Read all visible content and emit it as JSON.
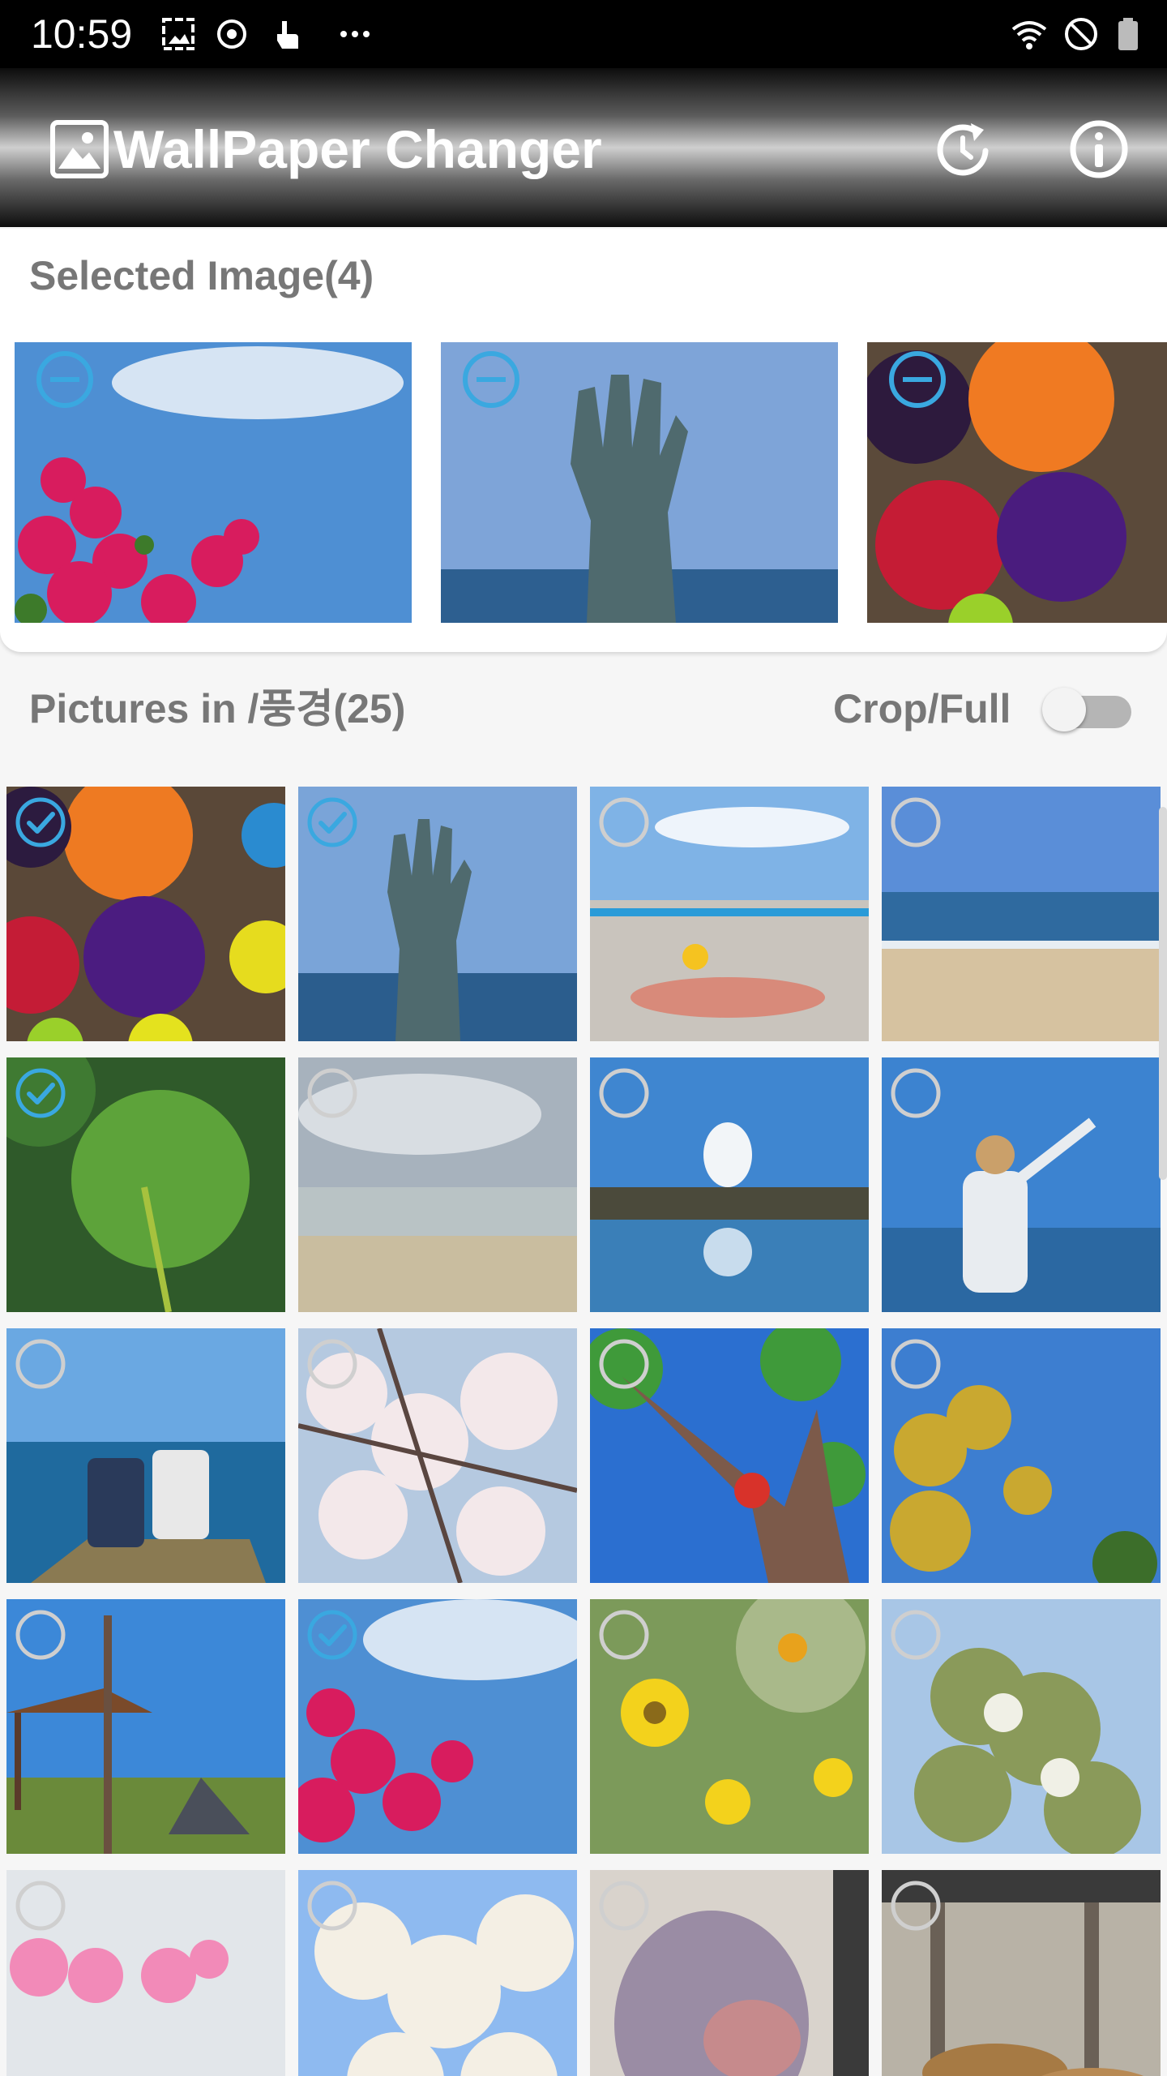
{
  "status_bar": {
    "time": "10:59",
    "left_icons": [
      "gallery-icon",
      "sync-icon",
      "touch-icon",
      "more-dots-icon"
    ],
    "right_icons": [
      "wifi-icon",
      "do-not-disturb-icon",
      "battery-icon"
    ]
  },
  "app_bar": {
    "title": "WallPaper Changer",
    "logo_icon": "picture-frame-icon",
    "actions": [
      "refresh-timer-icon",
      "info-icon"
    ]
  },
  "selected": {
    "title": "Selected Image(4)",
    "items": [
      {
        "scene": "red flowers against blue sky",
        "action_icon": "minus-circle-icon"
      },
      {
        "scene": "hand sculpture in the sea",
        "action_icon": "minus-circle-icon"
      },
      {
        "scene": "colorful umbrellas on a wall",
        "action_icon": "minus-circle-icon"
      }
    ]
  },
  "folder": {
    "title": "Pictures in /풍경(25)",
    "crop_label": "Crop/Full",
    "crop_toggle_on": false
  },
  "grid": [
    {
      "scene": "colorful umbrellas",
      "checked": true
    },
    {
      "scene": "hand sculpture in sea",
      "checked": true
    },
    {
      "scene": "pier with octopus painting",
      "checked": false
    },
    {
      "scene": "sandy beach and sea",
      "checked": false
    },
    {
      "scene": "lotus leaf with dragonfly",
      "checked": true
    },
    {
      "scene": "people wading on shore",
      "checked": false
    },
    {
      "scene": "calm water reflecting sky",
      "checked": false
    },
    {
      "scene": "person pointing at the sea",
      "checked": false
    },
    {
      "scene": "two kids sitting on a pier",
      "checked": false
    },
    {
      "scene": "cherry blossoms",
      "checked": false
    },
    {
      "scene": "playground tree sculpture",
      "checked": false
    },
    {
      "scene": "yellow tree against blue sky",
      "checked": false
    },
    {
      "scene": "campsite with gazebo",
      "checked": false
    },
    {
      "scene": "red flowers against blue sky",
      "checked": true
    },
    {
      "scene": "yellow wildflowers",
      "checked": false
    },
    {
      "scene": "tree in spring bloom",
      "checked": false
    },
    {
      "scene": "pink peach blossoms",
      "checked": false
    },
    {
      "scene": "white blossoming tree",
      "checked": false
    },
    {
      "scene": "bear statue",
      "checked": false
    },
    {
      "scene": "lions resting in shelter",
      "checked": false
    }
  ],
  "colors": {
    "accent": "#3aa8e0",
    "unchecked": "#cfcfcf",
    "label_gray": "#777777"
  }
}
